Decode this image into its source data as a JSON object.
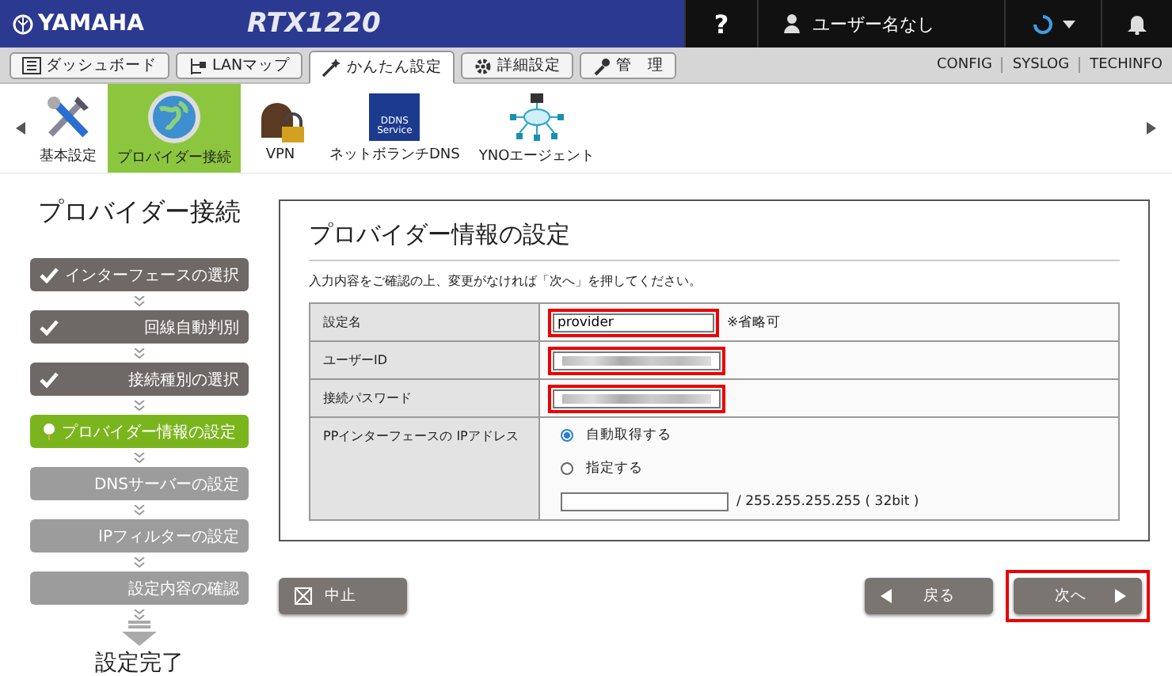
{
  "header": {
    "brand": "YAMAHA",
    "model": "RTX1220",
    "help": "?",
    "user": "ユーザー名なし"
  },
  "tabs": [
    {
      "label": "ダッシュボード",
      "selected": false
    },
    {
      "label": "LANマップ",
      "selected": false
    },
    {
      "label": "かんたん設定",
      "selected": true
    },
    {
      "label": "詳細設定",
      "selected": false
    },
    {
      "label": "管　理",
      "selected": false
    }
  ],
  "links": [
    "CONFIG",
    "SYSLOG",
    "TECHINFO"
  ],
  "features": [
    {
      "label": "基本設定",
      "selected": false
    },
    {
      "label": "プロバイダー接続",
      "selected": true
    },
    {
      "label": "VPN",
      "selected": false
    },
    {
      "label": "ネットボランチDNS",
      "selected": false,
      "badge": "DDNS Service"
    },
    {
      "label": "YNOエージェント",
      "selected": false
    }
  ],
  "sidebar": {
    "title": "プロバイダー接続",
    "steps": [
      {
        "label": "インターフェースの選択",
        "kind": "done"
      },
      {
        "label": "回線自動判別",
        "kind": "done"
      },
      {
        "label": "接続種別の選択",
        "kind": "done"
      },
      {
        "label": "プロバイダー情報の設定",
        "kind": "current"
      },
      {
        "label": "DNSサーバーの設定",
        "kind": "pending"
      },
      {
        "label": "IPフィルターの設定",
        "kind": "pending"
      },
      {
        "label": "設定内容の確認",
        "kind": "pending"
      }
    ],
    "final": "設定完了"
  },
  "form": {
    "title": "プロバイダー情報の設定",
    "instruction": "入力内容をご確認の上、変更がなければ「次へ」を押してください。",
    "rows": [
      {
        "kind": "text",
        "label": "設定名",
        "value": "provider",
        "note": "※省略可",
        "highlighted": true
      },
      {
        "kind": "blurred",
        "label": "ユーザーID",
        "highlighted": true
      },
      {
        "kind": "blurred",
        "label": "接続パスワード",
        "highlighted": true
      },
      {
        "kind": "radio",
        "label": "PPインターフェースの IPアドレス",
        "options": [
          {
            "label": "自動取得する",
            "selected": true
          },
          {
            "label": "指定する",
            "selected": false
          }
        ],
        "suffix": "/ 255.255.255.255 ( 32bit )"
      }
    ]
  },
  "actions": {
    "cancel": {
      "label": "中止"
    },
    "back": {
      "label": "戻る"
    },
    "next": {
      "label": "次へ",
      "highlighted": true
    }
  }
}
